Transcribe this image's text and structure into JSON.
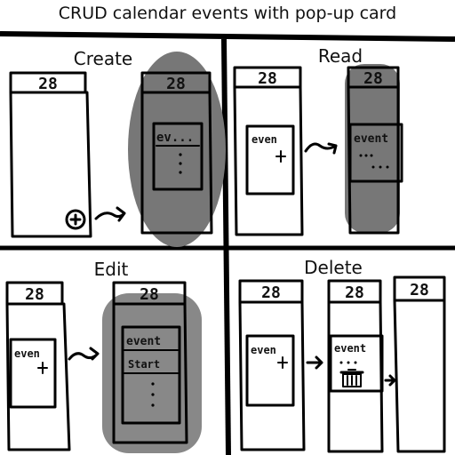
{
  "title": "CRUD calendar events with pop-up card",
  "panels": [
    {
      "label": "Create",
      "date": "28",
      "card_text": "ev..."
    },
    {
      "label": "Read",
      "date": "28",
      "event_text": "even",
      "card_text": "event"
    },
    {
      "label": "Edit",
      "date": "28",
      "event_text": "even",
      "card_text": "event",
      "card_field": "Start"
    },
    {
      "label": "Delete",
      "date": "28",
      "event_text": "even",
      "card_text": "event"
    }
  ],
  "icons": [
    "add-icon",
    "arrow-icon",
    "trash-icon"
  ]
}
